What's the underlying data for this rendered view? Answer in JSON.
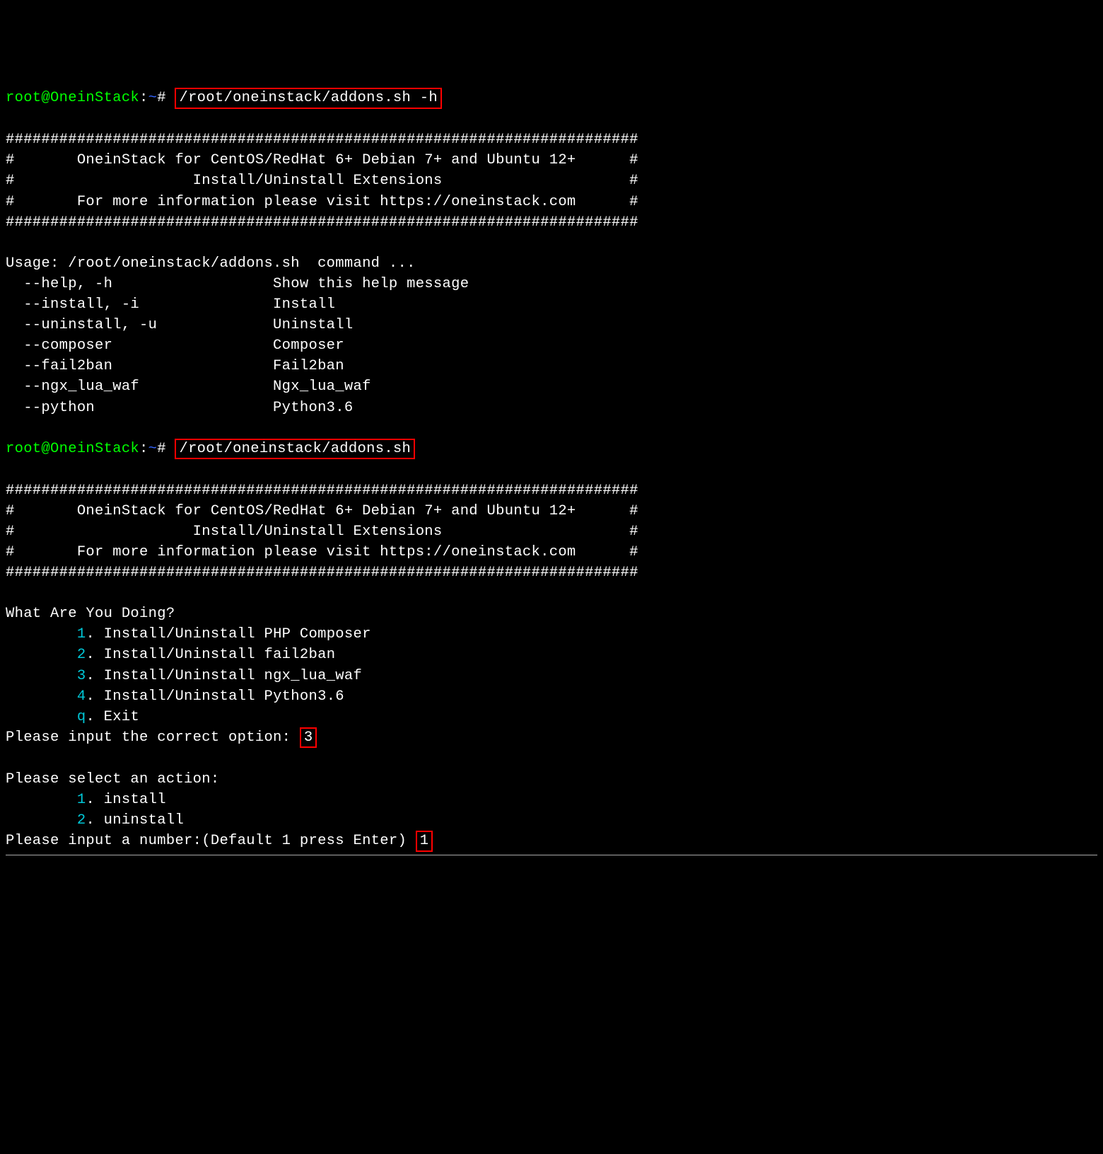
{
  "prompt": {
    "userhost": "root@OneinStack",
    "colon": ":",
    "tilde": "~",
    "hash": "# "
  },
  "cmd1": "/root/oneinstack/addons.sh -h",
  "cmd2": "/root/oneinstack/addons.sh",
  "banner": {
    "border": "#######################################################################",
    "line1": "#       OneinStack for CentOS/RedHat 6+ Debian 7+ and Ubuntu 12+      #",
    "line2": "#                    Install/Uninstall Extensions                     #",
    "line3": "#       For more information please visit https://oneinstack.com      #"
  },
  "usage": {
    "header": "Usage: /root/oneinstack/addons.sh  command ...",
    "opt_help": "  --help, -h                  Show this help message",
    "opt_install": "  --install, -i               Install",
    "opt_uninstall": "  --uninstall, -u             Uninstall",
    "opt_composer": "  --composer                  Composer",
    "opt_fail2ban": "  --fail2ban                  Fail2ban",
    "opt_ngx": "  --ngx_lua_waf               Ngx_lua_waf",
    "opt_python": "  --python                    Python3.6"
  },
  "menu": {
    "title": "What Are You Doing?",
    "indent": "        ",
    "items": [
      {
        "num": "1",
        "label": ". Install/Uninstall PHP Composer"
      },
      {
        "num": "2",
        "label": ". Install/Uninstall fail2ban"
      },
      {
        "num": "3",
        "label": ". Install/Uninstall ngx_lua_waf"
      },
      {
        "num": "4",
        "label": ". Install/Uninstall Python3.6"
      },
      {
        "num": "q",
        "label": ". Exit"
      }
    ],
    "prompt": "Please input the correct option: ",
    "input": "3"
  },
  "action": {
    "title": "Please select an action:",
    "indent": "        ",
    "items": [
      {
        "num": "1",
        "label": ". install"
      },
      {
        "num": "2",
        "label": ". uninstall"
      }
    ],
    "prompt": "Please input a number:(Default 1 press Enter) ",
    "input": "1"
  }
}
